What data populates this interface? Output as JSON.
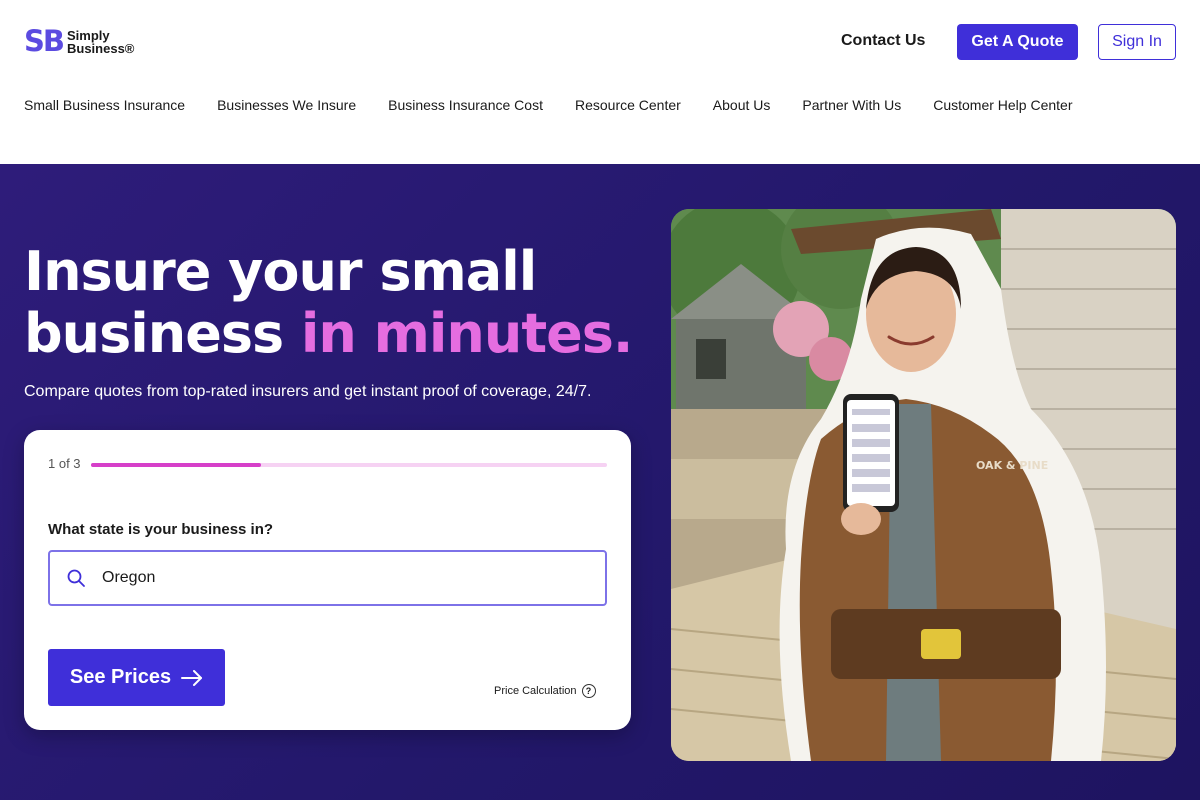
{
  "brand": {
    "logo_mark": "SB",
    "logo_line1": "Simply",
    "logo_line2": "Business®"
  },
  "header": {
    "contact_label": "Contact Us",
    "quote_label": "Get A Quote",
    "signin_label": "Sign In"
  },
  "nav": {
    "items": [
      {
        "label": "Small Business Insurance"
      },
      {
        "label": "Businesses We Insure"
      },
      {
        "label": "Business Insurance Cost"
      },
      {
        "label": "Resource Center"
      },
      {
        "label": "About Us"
      },
      {
        "label": "Partner With Us"
      },
      {
        "label": "Customer Help Center"
      }
    ]
  },
  "hero": {
    "headline_line1": "Insure your small",
    "headline_line2_plain": "business ",
    "headline_line2_accent": "in minutes.",
    "subhead": "Compare quotes from top-rated insurers and get instant proof of coverage, 24/7."
  },
  "form": {
    "step_label": "1 of 3",
    "progress_percent": 33,
    "question": "What state is your business in?",
    "state_value": "Oregon",
    "submit_label": "See Prices",
    "price_calc_label": "Price Calculation",
    "help_glyph": "?"
  },
  "photo": {
    "jacket_text": "OAK & PINE"
  },
  "colors": {
    "brand": "#3f2fd9",
    "accent": "#e56de0",
    "hero_bg": "#23186b",
    "progress": "#d63fc9"
  },
  "icons": [
    "search-icon",
    "arrow-right-icon",
    "help-circle-icon"
  ]
}
